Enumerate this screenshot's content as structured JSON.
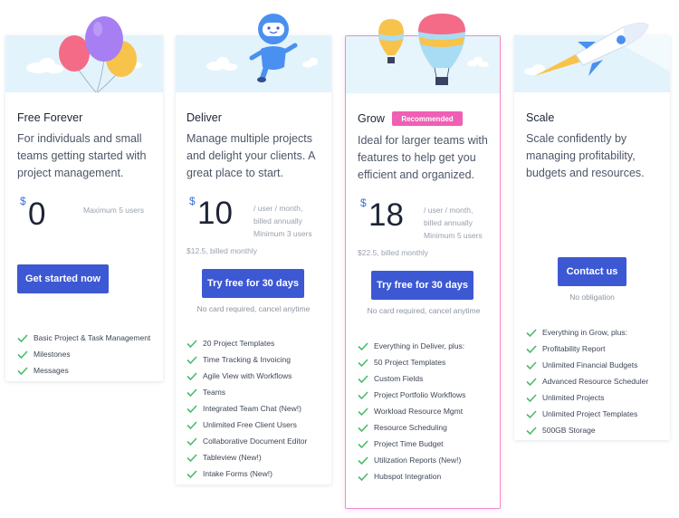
{
  "colors": {
    "accent": "#3d58d3",
    "check": "#4cbb6c",
    "badge": "#ef5fb4",
    "banner": "#e3f3fb"
  },
  "plans": [
    {
      "name": "Free Forever",
      "description": "For individuals and small teams getting started with project management.",
      "currency": "$",
      "price": "0",
      "price_note": "Maximum 5 users",
      "cta": "Get started now",
      "features": [
        "Basic Project & Task Management",
        "Milestones",
        "Messages"
      ],
      "illustration": "balloons-illustration"
    },
    {
      "name": "Deliver",
      "description": "Manage multiple projects and delight your clients. A great place to start.",
      "currency": "$",
      "price": "10",
      "price_note": [
        "/ user / month,",
        "billed annually",
        "Minimum 3 users"
      ],
      "monthly": "$12.5, billed monthly",
      "cta": "Try free for 30 days",
      "cta_sub": "No card required, cancel anytime",
      "features": [
        "20 Project Templates",
        "Time Tracking & Invoicing",
        "Agile View with Workflows",
        "Teams",
        "Integrated Team Chat (New!)",
        "Unlimited Free Client Users",
        "Collaborative Document Editor",
        "Tableview (New!)",
        "Intake Forms (New!)"
      ],
      "illustration": "robot-illustration"
    },
    {
      "name": "Grow",
      "badge": "Recommended",
      "description": "Ideal for larger teams with features to help get you efficient and organized.",
      "currency": "$",
      "price": "18",
      "price_note": [
        "/ user / month,",
        "billed annually",
        "Minimum 5 users"
      ],
      "monthly": "$22.5, billed monthly",
      "cta": "Try free for 30 days",
      "cta_sub": "No card required, cancel anytime",
      "features": [
        "Everything in Deliver, plus:",
        "50 Project Templates",
        "Custom Fields",
        "Project Portfolio Workflows",
        "Workload Resource Mgmt",
        "Resource Scheduling",
        "Project Time Budget",
        "Utilization Reports (New!)",
        "Hubspot Integration"
      ],
      "illustration": "hot-air-balloons-illustration"
    },
    {
      "name": "Scale",
      "description": "Scale confidently by managing profitability, budgets and resources.",
      "cta": "Contact us",
      "cta_sub": "No obligation",
      "features": [
        "Everything in Grow, plus:",
        "Profitability Report",
        "Unlimited Financial Budgets",
        "Advanced Resource Scheduler",
        "Unlimited Projects",
        "Unlimited Project Templates",
        "500GB Storage"
      ],
      "illustration": "rocket-illustration"
    }
  ]
}
